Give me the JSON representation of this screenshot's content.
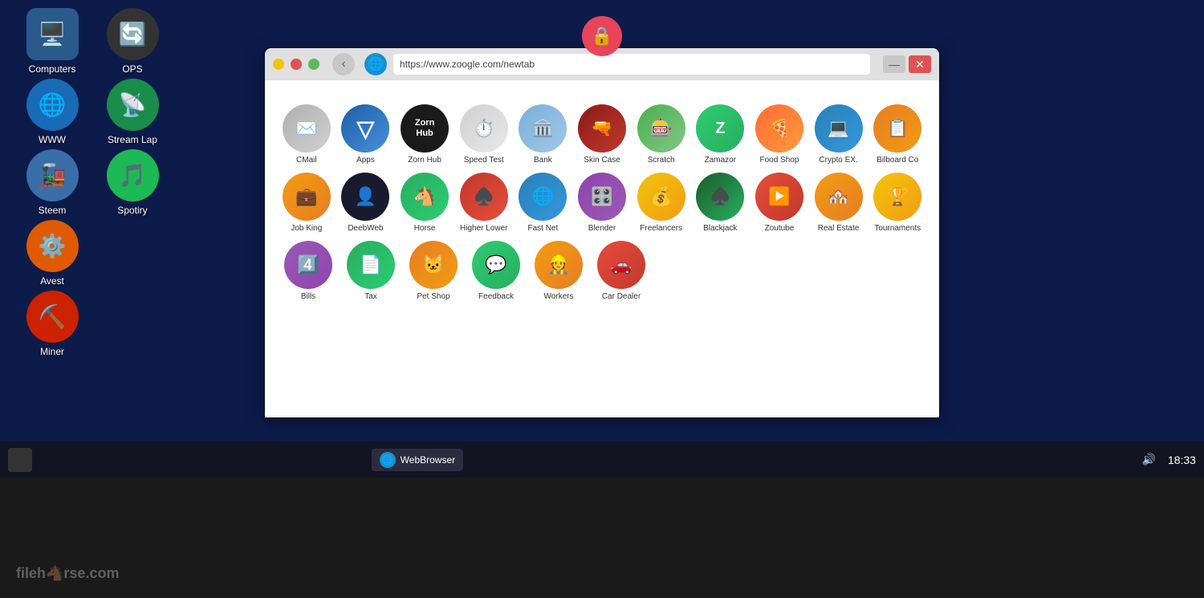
{
  "desktop": {
    "icons": [
      {
        "id": "computers",
        "label": "Computers",
        "bg": "#2a5a8c",
        "emoji": "🖥️",
        "shape": "square"
      },
      {
        "id": "ops",
        "label": "OPS",
        "bg": "#333",
        "emoji": "🔄",
        "shape": "circle"
      },
      {
        "id": "www",
        "label": "WWW",
        "bg": "#1a6bb5",
        "emoji": "🌐",
        "shape": "circle"
      },
      {
        "id": "streamlap",
        "label": "Stream Lap",
        "bg": "#1a8c4a",
        "emoji": "📡",
        "shape": "circle"
      },
      {
        "id": "steem",
        "label": "Steem",
        "bg": "#3a6ea8",
        "emoji": "🚂",
        "shape": "circle"
      },
      {
        "id": "spotiry",
        "label": "Spotiry",
        "bg": "#1db954",
        "emoji": "🎵",
        "shape": "circle"
      },
      {
        "id": "avest",
        "label": "Avest",
        "bg": "#e05a00",
        "emoji": "⚙️",
        "shape": "circle"
      },
      {
        "id": "miner",
        "label": "Miner",
        "bg": "#cc2200",
        "emoji": "⛏️",
        "shape": "circle"
      }
    ]
  },
  "browser": {
    "url": "https://www.zoogle.com/newtab",
    "title": "WebBrowser"
  },
  "apps": {
    "rows": [
      [
        {
          "id": "cmail",
          "label": "CMail",
          "emoji": "✉️",
          "bg": "linear-gradient(135deg,#b0b0b0,#d0d0d0)"
        },
        {
          "id": "apps",
          "label": "Apps",
          "emoji": "▽",
          "bg": "linear-gradient(135deg,#1a5fa8,#4a90d9)"
        },
        {
          "id": "zornhub",
          "label": "Zorn Hub",
          "emoji": "ZH",
          "bg": "#1a1a1a"
        },
        {
          "id": "speedtest",
          "label": "Speed Test",
          "emoji": "⏱️",
          "bg": "linear-gradient(135deg,#d0d0d0,#e8e8e8)"
        },
        {
          "id": "bank",
          "label": "Bank",
          "emoji": "🏛️",
          "bg": "linear-gradient(135deg,#7ab0d8,#a0c8e8)"
        },
        {
          "id": "skincase",
          "label": "Skin Case",
          "emoji": "🔫",
          "bg": "linear-gradient(135deg,#c0392b,#e74c3c)"
        },
        {
          "id": "scratch",
          "label": "Scratch",
          "emoji": "🎰",
          "bg": "linear-gradient(135deg,#4caf50,#81c784)"
        },
        {
          "id": "zamazor",
          "label": "Zamazor",
          "emoji": "Z",
          "bg": "linear-gradient(135deg,#2ecc71,#27ae60)"
        },
        {
          "id": "foodshop",
          "label": "Food Shop",
          "emoji": "🍕",
          "bg": "linear-gradient(135deg,#ff6b35,#ff9a3c)"
        },
        {
          "id": "cryptoex",
          "label": "Crypto EX.",
          "emoji": "💻",
          "bg": "linear-gradient(135deg,#3498db,#2980b9)"
        },
        {
          "id": "billboard",
          "label": "Bilboard Co",
          "emoji": "📋",
          "bg": "linear-gradient(135deg,#e67e22,#f39c12)"
        }
      ],
      [
        {
          "id": "jobking",
          "label": "Job King",
          "emoji": "💼",
          "bg": "linear-gradient(135deg,#f39c12,#e67e22)"
        },
        {
          "id": "deepweb",
          "label": "DeebWeb",
          "emoji": "👤",
          "bg": "#1a1a2e"
        },
        {
          "id": "horse",
          "label": "Horse",
          "emoji": "🐴",
          "bg": "linear-gradient(135deg,#27ae60,#2ecc71)"
        },
        {
          "id": "higherlower",
          "label": "Higher Lower",
          "emoji": "♠️",
          "bg": "linear-gradient(135deg,#c0392b,#e74c3c)"
        },
        {
          "id": "fastnet",
          "label": "Fast Net",
          "emoji": "🌐",
          "bg": "linear-gradient(135deg,#2980b9,#3498db)"
        },
        {
          "id": "blender",
          "label": "Blender",
          "emoji": "🎛️",
          "bg": "linear-gradient(135deg,#8e44ad,#9b59b6)"
        },
        {
          "id": "freelancers",
          "label": "Freelancers",
          "emoji": "💰",
          "bg": "linear-gradient(135deg,#f1c40f,#f39c12)"
        },
        {
          "id": "blackjack",
          "label": "Blackjack",
          "emoji": "♠️",
          "bg": "linear-gradient(135deg,#1a5c2a,#27ae60)"
        },
        {
          "id": "zoutube",
          "label": "Zoutube",
          "emoji": "▶️",
          "bg": "linear-gradient(135deg,#e74c3c,#c0392b)"
        },
        {
          "id": "realestate",
          "label": "Real Estate",
          "emoji": "🏘️",
          "bg": "linear-gradient(135deg,#f39c12,#e67e22)"
        },
        {
          "id": "tournaments",
          "label": "Tournaments",
          "emoji": "🏆",
          "bg": "linear-gradient(135deg,#f1c40f,#f39c12)"
        }
      ],
      [
        {
          "id": "bills",
          "label": "Bills",
          "emoji": "4️⃣",
          "bg": "linear-gradient(135deg,#9b59b6,#8e44ad)"
        },
        {
          "id": "tax",
          "label": "Tax",
          "emoji": "📄",
          "bg": "linear-gradient(135deg,#27ae60,#2ecc71)"
        },
        {
          "id": "petshop",
          "label": "Pet Shop",
          "emoji": "🐱",
          "bg": "linear-gradient(135deg,#e67e22,#f39c12)"
        },
        {
          "id": "feedback",
          "label": "Feedback",
          "emoji": "💬",
          "bg": "linear-gradient(135deg,#2ecc71,#27ae60)"
        },
        {
          "id": "workers",
          "label": "Workers",
          "emoji": "👷",
          "bg": "linear-gradient(135deg,#f39c12,#e67e22)"
        },
        {
          "id": "cardealer",
          "label": "Car Dealer",
          "emoji": "🚗",
          "bg": "linear-gradient(135deg,#e74c3c,#c0392b)"
        }
      ]
    ]
  },
  "taskbar": {
    "browser_label": "WebBrowser",
    "time": "18:33",
    "volume_icon": "🔊"
  },
  "watermark": "fileh🐴rse.com"
}
